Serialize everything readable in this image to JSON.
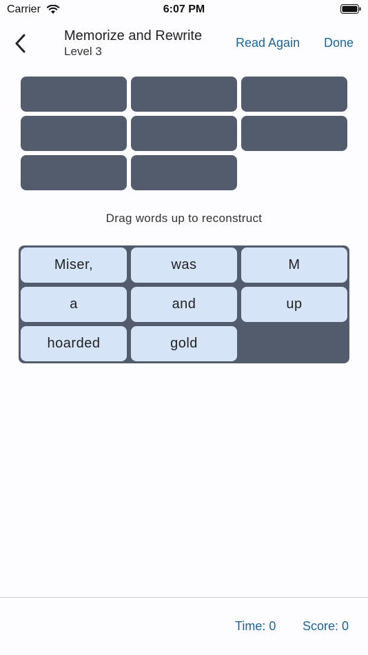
{
  "status_bar": {
    "carrier": "Carrier",
    "time": "6:07 PM"
  },
  "nav": {
    "title": "Memorize and Rewrite",
    "subtitle": "Level 3",
    "read_again_label": "Read Again",
    "done_label": "Done",
    "accent_color": "#1c6499"
  },
  "answer_slots": {
    "count": 8,
    "color": "#525c6d"
  },
  "instruction": "Drag words up to reconstruct",
  "word_bank": {
    "background_color": "#525c6d",
    "chip_color": "#d6e4f7",
    "words": [
      "Miser,",
      "was",
      "M",
      "a",
      "and",
      "up",
      "hoarded",
      "gold"
    ]
  },
  "footer": {
    "time_label": "Time: 0",
    "score_label": "Score: 0"
  }
}
